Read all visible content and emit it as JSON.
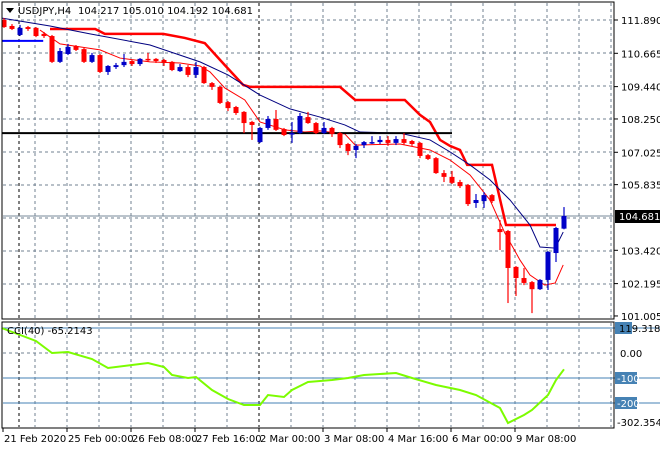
{
  "header": {
    "symbol": "USDJPY,H4",
    "ohlc": "104.217 105.010 104.192 104.681"
  },
  "price_axis": {
    "labels": [
      "111.890",
      "110.665",
      "109.440",
      "108.250",
      "107.025",
      "105.835",
      "103.420",
      "102.195",
      "101.005"
    ],
    "values": [
      111.89,
      110.665,
      109.44,
      108.25,
      107.025,
      105.835,
      103.42,
      102.195,
      101.005
    ],
    "current": "104.681",
    "current_value": 104.681
  },
  "indicator": {
    "title": "CCI(40) -65.2143",
    "axis_labels": {
      "max": "119.3183",
      "zero": "0.00",
      "m100": "-100",
      "m200": "-200",
      "min": "-302.3548"
    },
    "levels": [
      100,
      -100,
      -200
    ]
  },
  "time_axis": {
    "labels": [
      "21 Feb 2020",
      "25 Feb 00:00",
      "26 Feb 08:00",
      "27 Feb 16:00",
      "2 Mar 00:00",
      "3 Mar 08:00",
      "4 Mar 16:00",
      "6 Mar 00:00",
      "9 Mar 08:00"
    ],
    "bar_index": [
      0,
      8,
      16,
      24,
      32,
      40,
      48,
      56,
      64
    ]
  },
  "colors": {
    "bull": "#0000C8",
    "bear": "#FF0000",
    "ma_blue": "#000080",
    "ma_red": "#FF0000",
    "cci": "#7CFC00",
    "level": "#4682B4",
    "grid": "#708090"
  },
  "chart_data": {
    "type": "candlestick",
    "title": "USDJPY,H4",
    "ylim": [
      101.005,
      111.89
    ],
    "candles_ohlc": [
      [
        111.89,
        111.96,
        111.6,
        111.63
      ],
      [
        111.67,
        111.74,
        111.52,
        111.56
      ],
      [
        111.34,
        111.71,
        111.3,
        111.6
      ],
      [
        111.63,
        111.67,
        111.49,
        111.56
      ],
      [
        111.6,
        111.63,
        111.26,
        111.3
      ],
      [
        111.38,
        111.45,
        111.23,
        111.3
      ],
      [
        111.3,
        111.34,
        110.31,
        110.35
      ],
      [
        110.35,
        110.86,
        110.31,
        110.75
      ],
      [
        110.64,
        111.01,
        110.6,
        110.9
      ],
      [
        110.93,
        110.97,
        110.75,
        110.79
      ],
      [
        110.82,
        110.86,
        110.31,
        110.35
      ],
      [
        110.35,
        110.68,
        110.31,
        110.6
      ],
      [
        110.6,
        110.64,
        109.94,
        109.98
      ],
      [
        109.98,
        110.23,
        109.87,
        110.2
      ],
      [
        110.16,
        110.31,
        110.09,
        110.23
      ],
      [
        110.23,
        110.64,
        110.16,
        110.35
      ],
      [
        110.38,
        110.42,
        110.2,
        110.27
      ],
      [
        110.27,
        110.49,
        110.2,
        110.46
      ],
      [
        110.46,
        110.68,
        110.35,
        110.42
      ],
      [
        110.46,
        110.49,
        110.31,
        110.38
      ],
      [
        110.42,
        110.46,
        110.2,
        110.31
      ],
      [
        110.35,
        110.38,
        110.01,
        110.05
      ],
      [
        110.01,
        110.27,
        109.98,
        110.16
      ],
      [
        110.16,
        110.23,
        109.79,
        109.87
      ],
      [
        109.87,
        110.35,
        109.76,
        110.16
      ],
      [
        110.16,
        110.2,
        109.54,
        109.57
      ],
      [
        109.57,
        109.61,
        109.32,
        109.43
      ],
      [
        109.43,
        109.46,
        108.8,
        108.84
      ],
      [
        108.87,
        108.91,
        108.54,
        108.65
      ],
      [
        108.69,
        108.73,
        108.4,
        108.47
      ],
      [
        108.51,
        108.54,
        107.73,
        108.1
      ],
      [
        108.14,
        108.18,
        107.48,
        108.03
      ],
      [
        107.4,
        107.96,
        107.37,
        107.92
      ],
      [
        107.92,
        108.36,
        107.85,
        108.25
      ],
      [
        108.25,
        108.58,
        107.81,
        107.85
      ],
      [
        107.88,
        107.92,
        107.62,
        107.66
      ],
      [
        107.7,
        108.14,
        107.37,
        107.73
      ],
      [
        107.73,
        108.47,
        107.7,
        108.36
      ],
      [
        108.32,
        108.51,
        108.07,
        108.1
      ],
      [
        108.1,
        108.14,
        107.7,
        107.73
      ],
      [
        107.73,
        108.14,
        107.7,
        107.92
      ],
      [
        107.92,
        107.96,
        107.59,
        107.7
      ],
      [
        107.73,
        107.77,
        107.18,
        107.29
      ],
      [
        107.33,
        107.37,
        106.92,
        107.07
      ],
      [
        107.11,
        107.33,
        106.81,
        107.26
      ],
      [
        107.29,
        107.44,
        107.18,
        107.4
      ],
      [
        107.37,
        107.62,
        107.33,
        107.4
      ],
      [
        107.4,
        107.62,
        107.33,
        107.48
      ],
      [
        107.48,
        107.62,
        107.26,
        107.37
      ],
      [
        107.37,
        107.62,
        107.29,
        107.51
      ],
      [
        107.51,
        107.73,
        107.29,
        107.37
      ],
      [
        107.44,
        107.48,
        107.26,
        107.33
      ],
      [
        107.37,
        107.4,
        106.81,
        106.89
      ],
      [
        106.92,
        106.96,
        106.74,
        106.78
      ],
      [
        106.81,
        106.85,
        106.23,
        106.26
      ],
      [
        106.26,
        106.37,
        105.93,
        106.12
      ],
      [
        106.12,
        106.34,
        105.86,
        105.9
      ],
      [
        105.93,
        106.01,
        105.71,
        105.78
      ],
      [
        105.82,
        105.86,
        105.05,
        105.12
      ],
      [
        105.16,
        105.49,
        104.98,
        105.27
      ],
      [
        105.23,
        105.56,
        104.98,
        105.45
      ],
      [
        105.45,
        105.49,
        105.16,
        105.23
      ],
      [
        104.2,
        104.53,
        103.43,
        104.09
      ],
      [
        104.13,
        104.17,
        101.48,
        102.77
      ],
      [
        102.81,
        102.84,
        101.74,
        102.4
      ],
      [
        102.4,
        102.77,
        102.14,
        102.22
      ],
      [
        102.25,
        102.29,
        101.11,
        101.99
      ],
      [
        101.99,
        102.36,
        101.96,
        102.33
      ],
      [
        102.33,
        103.39,
        101.96,
        103.36
      ],
      [
        103.32,
        104.28,
        102.99,
        104.24
      ],
      [
        104.217,
        105.01,
        104.192,
        104.681
      ]
    ],
    "lines": [
      {
        "name": "trailing-stop",
        "color": "#FF0000",
        "width": 2.5,
        "points": [
          [
            5.75,
            111.56
          ],
          [
            11.4,
            111.56
          ],
          [
            12.6,
            111.38
          ],
          [
            19.9,
            111.38
          ],
          [
            22.6,
            111.23
          ],
          [
            25.1,
            111.04
          ],
          [
            27.6,
            110.23
          ],
          [
            29.9,
            109.5
          ],
          [
            30.75,
            109.43
          ],
          [
            42,
            109.43
          ],
          [
            43.9,
            108.95
          ],
          [
            50.1,
            108.95
          ],
          [
            52,
            108.4
          ],
          [
            53.25,
            108.14
          ],
          [
            54.5,
            107.48
          ],
          [
            55.75,
            107.26
          ],
          [
            57,
            107.11
          ],
          [
            57.9,
            106.56
          ],
          [
            61,
            106.56
          ],
          [
            62.75,
            104.35
          ],
          [
            69,
            104.35
          ]
        ]
      },
      {
        "name": "ma-slow",
        "color": "#000080",
        "width": 1,
        "points": [
          [
            -0.25,
            111.96
          ],
          [
            5.75,
            111.67
          ],
          [
            10.75,
            111.38
          ],
          [
            18.25,
            110.97
          ],
          [
            24.5,
            110.35
          ],
          [
            28,
            109.87
          ],
          [
            32,
            109.13
          ],
          [
            35.75,
            108.62
          ],
          [
            39.5,
            108.32
          ],
          [
            42.6,
            108.03
          ],
          [
            44.5,
            107.77
          ],
          [
            49.5,
            107.73
          ],
          [
            53.25,
            107.48
          ],
          [
            55.75,
            107.04
          ],
          [
            58.25,
            106.56
          ],
          [
            60.75,
            106.01
          ],
          [
            63.25,
            105.27
          ],
          [
            65.75,
            104.35
          ],
          [
            67,
            103.54
          ],
          [
            68.9,
            103.5
          ],
          [
            69.9,
            104.09
          ]
        ]
      },
      {
        "name": "ma-fast",
        "color": "#FF0000",
        "width": 1,
        "points": [
          [
            4.5,
            111.52
          ],
          [
            7,
            111.01
          ],
          [
            12,
            110.79
          ],
          [
            14.5,
            110.49
          ],
          [
            18.25,
            110.35
          ],
          [
            22,
            110.31
          ],
          [
            24.5,
            110.2
          ],
          [
            25.75,
            109.98
          ],
          [
            27.6,
            109.39
          ],
          [
            30.1,
            108.95
          ],
          [
            32,
            108.14
          ],
          [
            35.1,
            107.85
          ],
          [
            37.6,
            107.77
          ],
          [
            39.5,
            107.81
          ],
          [
            42.6,
            107.7
          ],
          [
            43.9,
            107.29
          ],
          [
            49.5,
            107.33
          ],
          [
            53.25,
            107.11
          ],
          [
            55.75,
            106.74
          ],
          [
            58.25,
            106.19
          ],
          [
            60.75,
            105.27
          ],
          [
            62.6,
            104.06
          ],
          [
            64.5,
            103.06
          ],
          [
            65.75,
            102.51
          ],
          [
            67.6,
            102.14
          ],
          [
            68.9,
            102.22
          ],
          [
            69.9,
            102.88
          ]
        ]
      },
      {
        "name": "level-blue",
        "color": "#0000FF",
        "width": 2,
        "points": [
          [
            -0.25,
            111.12
          ],
          [
            4.9,
            111.12
          ]
        ]
      },
      {
        "name": "level-black",
        "color": "#000000",
        "width": 2,
        "points": [
          [
            -0.25,
            107.73
          ],
          [
            56,
            107.73
          ]
        ]
      }
    ],
    "cci": {
      "ylim": [
        -302.3548,
        119.3183
      ],
      "points": [
        [
          -0.3,
          100
        ],
        [
          4,
          48
        ],
        [
          6,
          0
        ],
        [
          8,
          4
        ],
        [
          11,
          -24
        ],
        [
          13,
          -60
        ],
        [
          16,
          -48
        ],
        [
          18,
          -40
        ],
        [
          20,
          -56
        ],
        [
          21,
          -88
        ],
        [
          23,
          -100
        ],
        [
          24,
          -96
        ],
        [
          26,
          -148
        ],
        [
          28,
          -184
        ],
        [
          30,
          -208
        ],
        [
          32,
          -208
        ],
        [
          33,
          -168
        ],
        [
          35,
          -176
        ],
        [
          36,
          -148
        ],
        [
          38,
          -116
        ],
        [
          41,
          -108
        ],
        [
          43,
          -100
        ],
        [
          45,
          -88
        ],
        [
          49,
          -80
        ],
        [
          51,
          -100
        ],
        [
          54,
          -128
        ],
        [
          57,
          -148
        ],
        [
          59,
          -168
        ],
        [
          62,
          -220
        ],
        [
          63,
          -280
        ],
        [
          65,
          -248
        ],
        [
          66,
          -228
        ],
        [
          68,
          -168
        ],
        [
          69,
          -108
        ],
        [
          70,
          -65.2143
        ]
      ]
    }
  }
}
